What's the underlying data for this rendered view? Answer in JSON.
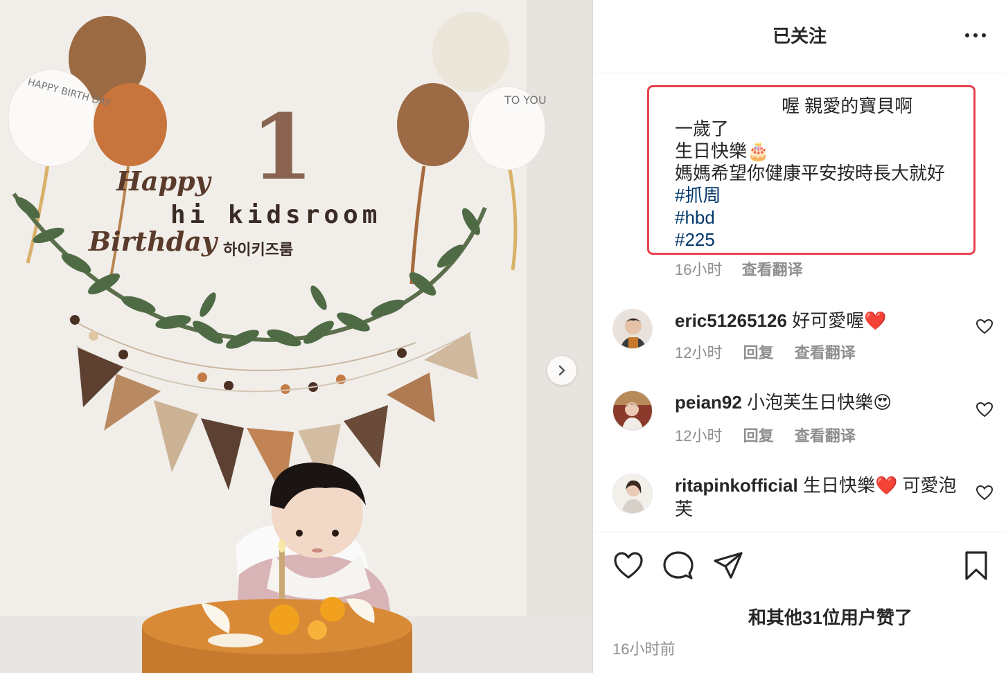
{
  "header": {
    "title": "已关注",
    "more_icon": "more-horizontal-icon"
  },
  "photo": {
    "balloon_left_text": "HAPPY BIRTH DAY",
    "balloon_right_text": "TO YOU",
    "number_one": "1",
    "happy": "Happy",
    "birthday": "Birthday",
    "brand": "hi kidsroom",
    "brand_korean": "하이키즈룸",
    "next_icon": "chevron-right-icon"
  },
  "caption": {
    "first_line": "喔 親愛的寶貝啊",
    "line1": "一歲了",
    "line2": "生日快樂🎂",
    "line3": "媽媽希望你健康平安按時長大就好",
    "hashtags": [
      "#抓周",
      "#hbd",
      "#225"
    ],
    "time": "16小时",
    "translate": "查看翻译"
  },
  "comments": [
    {
      "user": "eric51265126",
      "text": "好可愛喔❤️",
      "time": "12小时",
      "reply": "回复",
      "translate": "查看翻译"
    },
    {
      "user": "peian92",
      "text": "小泡芙生日快樂😍",
      "time": "12小时",
      "reply": "回复",
      "translate": "查看翻译"
    },
    {
      "user": "ritapinkofficial",
      "text": "生日快樂❤️ 可愛泡芙"
    }
  ],
  "actions": {
    "like_icon": "heart-icon",
    "comment_icon": "comment-icon",
    "share_icon": "send-icon",
    "save_icon": "bookmark-icon"
  },
  "likes": {
    "text": "和其他31位用户赞了"
  },
  "posted": "16小时前"
}
